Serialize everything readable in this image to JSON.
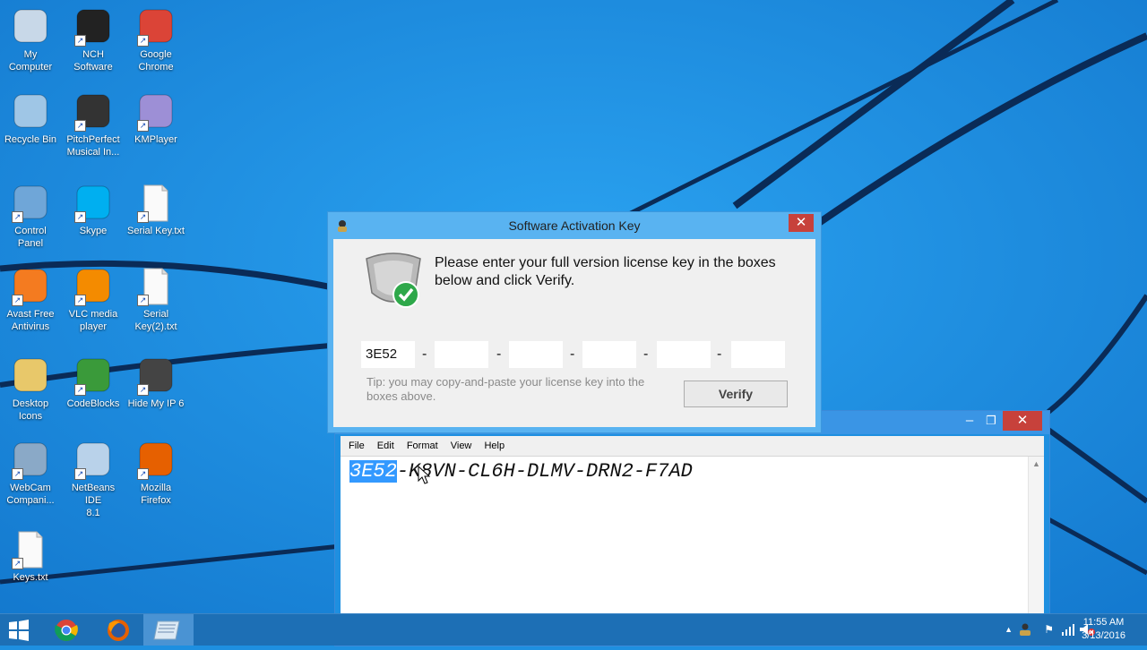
{
  "desktop_icons": [
    {
      "label": "My\nComputer",
      "icon": "computer-icon"
    },
    {
      "label": "NCH\nSoftware",
      "icon": "nch-icon"
    },
    {
      "label": "Google\nChrome",
      "icon": "chrome-icon"
    },
    {
      "label": "Recycle Bin",
      "icon": "recycle-bin-icon"
    },
    {
      "label": "PitchPerfect\nMusical In...",
      "icon": "pitchperfect-icon"
    },
    {
      "label": "KMPlayer",
      "icon": "kmplayer-icon"
    },
    {
      "label": "Control\nPanel",
      "icon": "control-panel-icon"
    },
    {
      "label": "Skype",
      "icon": "skype-icon"
    },
    {
      "label": "Serial Key.txt",
      "icon": "text-file-icon"
    },
    {
      "label": "Avast Free\nAntivirus",
      "icon": "avast-icon"
    },
    {
      "label": "VLC media\nplayer",
      "icon": "vlc-icon"
    },
    {
      "label": "Serial\nKey(2).txt",
      "icon": "text-file-icon"
    },
    {
      "label": "Desktop\nIcons",
      "icon": "folder-icon"
    },
    {
      "label": "CodeBlocks",
      "icon": "codeblocks-icon"
    },
    {
      "label": "Hide My IP 6",
      "icon": "hidemyip-icon"
    },
    {
      "label": "WebCam\nCompani...",
      "icon": "webcam-icon"
    },
    {
      "label": "NetBeans IDE\n8.1",
      "icon": "netbeans-icon"
    },
    {
      "label": "Mozilla\nFirefox",
      "icon": "firefox-icon"
    },
    {
      "label": "Keys.txt",
      "icon": "text-file-icon"
    }
  ],
  "dialog": {
    "title": "Software Activation Key",
    "message": "Please enter your full version license key in the boxes below and click Verify.",
    "key_fields": [
      "3E52",
      "",
      "",
      "",
      "",
      ""
    ],
    "separator": "-",
    "tip": "Tip: you may copy-and-paste your license key into the boxes above.",
    "verify_label": "Verify",
    "close_glyph": "✕"
  },
  "notepad": {
    "menu": [
      "File",
      "Edit",
      "Format",
      "View",
      "Help"
    ],
    "selected_text": "3E52",
    "rest_text": "-K8VN-CL6H-DLMV-DRN2-F7AD",
    "minimize_glyph": "–",
    "maximize_glyph": "❐",
    "close_glyph": "✕"
  },
  "taskbar": {
    "time": "11:55 AM",
    "date": "3/13/2016",
    "items": [
      "start-icon",
      "chrome-icon",
      "firefox-icon",
      "notepad-icon"
    ]
  },
  "colors": {
    "wallpaper": "#1e8fe0",
    "accent_red": "#c7413b",
    "selection": "#3399ff"
  }
}
